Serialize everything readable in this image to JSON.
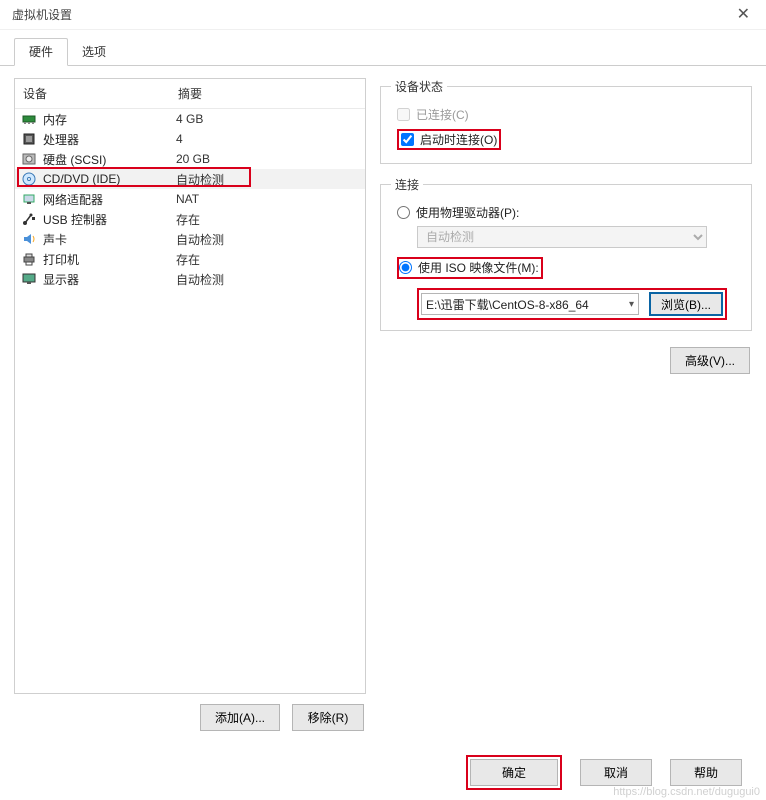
{
  "title": "虚拟机设置",
  "tabs": {
    "hardware": "硬件",
    "options": "选项",
    "active": "hardware"
  },
  "device_header": {
    "device": "设备",
    "summary": "摘要"
  },
  "devices": [
    {
      "name": "memory",
      "label": "内存",
      "summary": "4 GB",
      "icon": "ram"
    },
    {
      "name": "cpu",
      "label": "处理器",
      "summary": "4",
      "icon": "cpu"
    },
    {
      "name": "disk",
      "label": "硬盘 (SCSI)",
      "summary": "20 GB",
      "icon": "disk"
    },
    {
      "name": "cddvd",
      "label": "CD/DVD (IDE)",
      "summary": "自动检测",
      "icon": "cd",
      "selected": true
    },
    {
      "name": "net",
      "label": "网络适配器",
      "summary": "NAT",
      "icon": "net"
    },
    {
      "name": "usb",
      "label": "USB 控制器",
      "summary": "存在",
      "icon": "usb"
    },
    {
      "name": "sound",
      "label": "声卡",
      "summary": "自动检测",
      "icon": "sound"
    },
    {
      "name": "printer",
      "label": "打印机",
      "summary": "存在",
      "icon": "printer"
    },
    {
      "name": "display",
      "label": "显示器",
      "summary": "自动检测",
      "icon": "display"
    }
  ],
  "left_buttons": {
    "add": "添加(A)...",
    "remove": "移除(R)"
  },
  "status": {
    "legend": "设备状态",
    "connected": "已连接(C)",
    "connect_poweron": "启动时连接(O)",
    "connected_checked": false,
    "connect_poweron_checked": true
  },
  "connection": {
    "legend": "连接",
    "physical": "使用物理驱动器(P):",
    "physical_value": "自动检测",
    "iso": "使用 ISO 映像文件(M):",
    "iso_value": "E:\\迅雷下载\\CentOS-8-x86_64",
    "browse": "浏览(B)...",
    "selected": "iso"
  },
  "advanced": "高级(V)...",
  "footer": {
    "ok": "确定",
    "cancel": "取消",
    "help": "帮助"
  },
  "watermark": "https://blog.csdn.net/dugugui0"
}
